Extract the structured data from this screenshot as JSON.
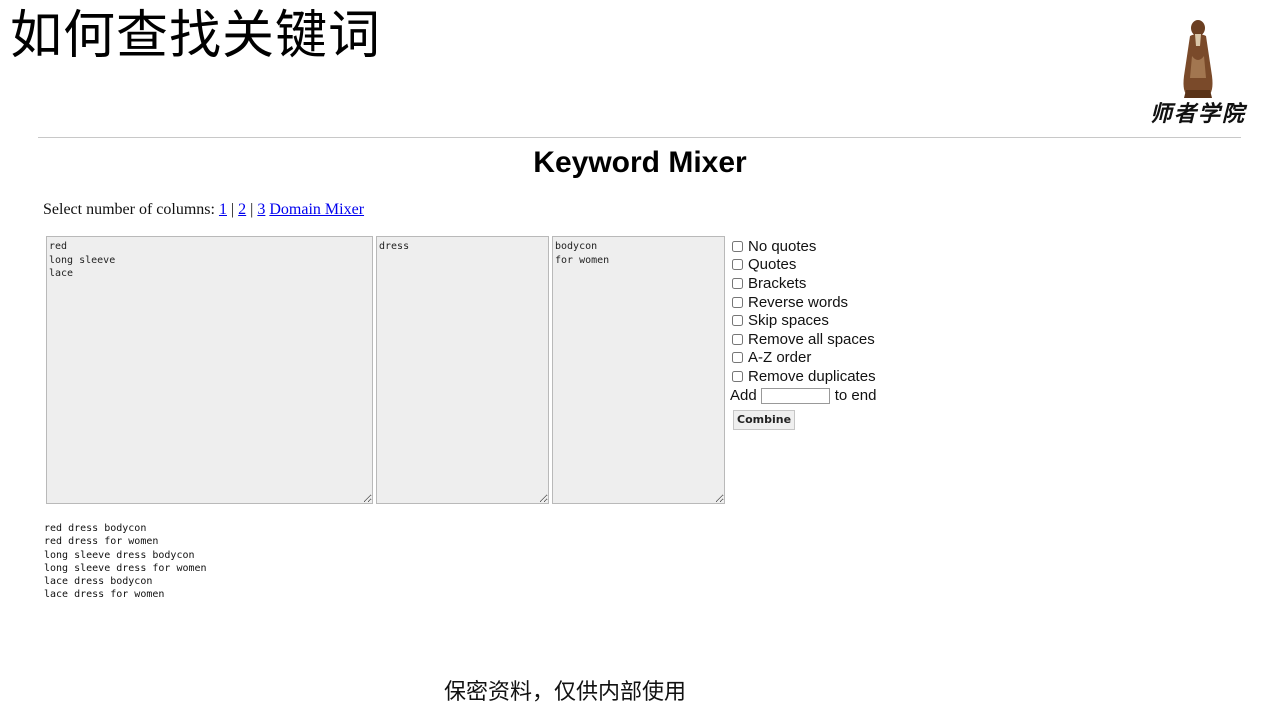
{
  "slide": {
    "title": "如何查找关键词",
    "logo_text": "师者学院",
    "footer": "保密资料，仅供内部使用"
  },
  "app": {
    "title": "Keyword Mixer",
    "column_select": {
      "label": "Select number of columns:",
      "links": [
        "1",
        "2",
        "3"
      ],
      "separator": "|",
      "domain_link": "Domain Mixer"
    },
    "columns": [
      "red\nlong sleeve\nlace",
      "dress",
      "bodycon\nfor women"
    ],
    "options": [
      {
        "label": "No quotes",
        "checked": false
      },
      {
        "label": "Quotes",
        "checked": false
      },
      {
        "label": "Brackets",
        "checked": false
      },
      {
        "label": "Reverse words",
        "checked": false
      },
      {
        "label": "Skip spaces",
        "checked": false
      },
      {
        "label": "Remove all spaces",
        "checked": false
      },
      {
        "label": "A-Z order",
        "checked": false
      },
      {
        "label": "Remove duplicates",
        "checked": false
      }
    ],
    "add": {
      "prefix": "Add",
      "suffix": "to end",
      "value": ""
    },
    "combine_label": "Combine",
    "results": [
      "red dress bodycon",
      "red dress for women",
      "long sleeve dress bodycon",
      "long sleeve dress for women",
      "lace dress bodycon",
      "lace dress for women"
    ]
  }
}
